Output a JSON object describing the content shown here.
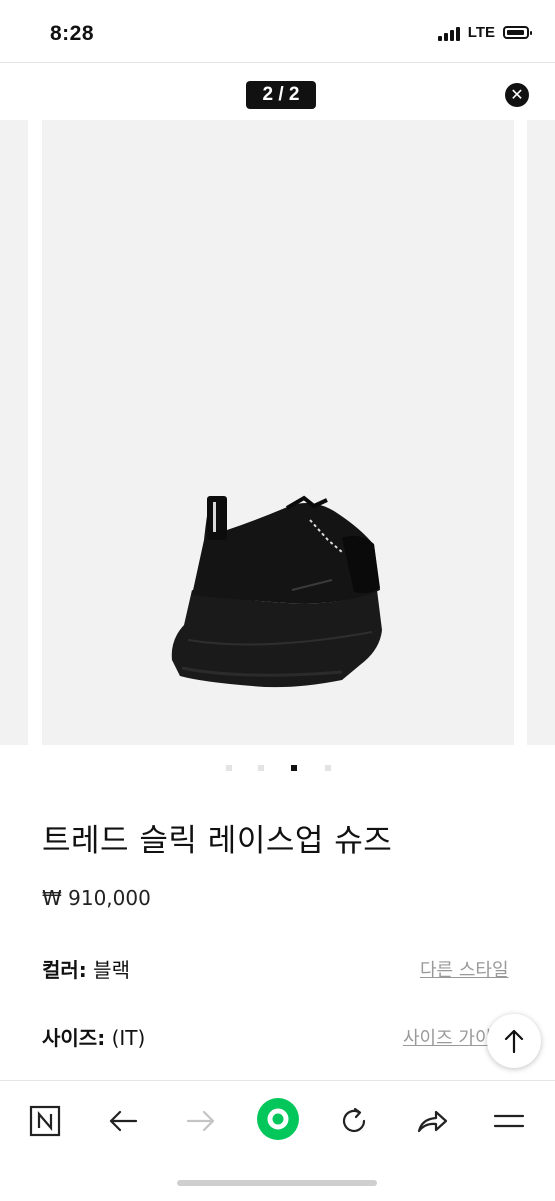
{
  "status_bar": {
    "time": "8:28",
    "carrier": "LTE"
  },
  "viewer": {
    "page_counter": "2 / 2",
    "close_icon": "close-icon"
  },
  "carousel": {
    "slide_count": 4,
    "active_index": 2
  },
  "product": {
    "title": "트레드 슬릭 레이스업 슈즈",
    "price": "₩ 910,000",
    "color_label": "컬러:",
    "color_value": "블랙",
    "other_styles_link": "다른 스타일",
    "size_label": "사이즈:",
    "size_value": "(IT)",
    "size_guide_link": "사이즈 가이드"
  },
  "bottom_nav": {
    "icons": [
      "naver-n-icon",
      "back-arrow-icon",
      "forward-arrow-icon",
      "home-green-icon",
      "refresh-icon",
      "share-icon",
      "menu-icon"
    ],
    "accent": "#03c75a"
  }
}
